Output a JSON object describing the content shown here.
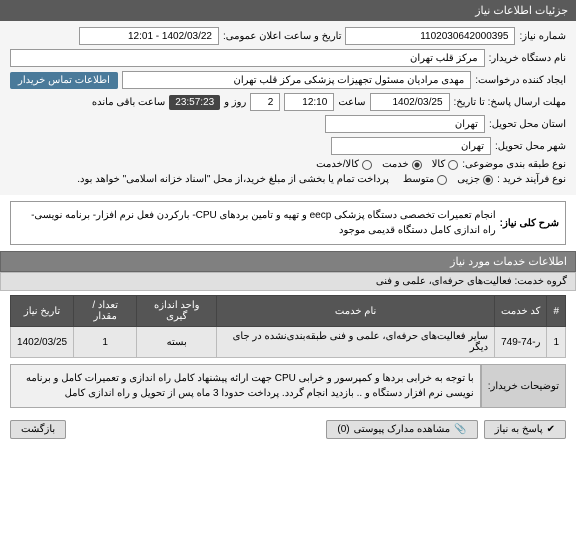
{
  "header": {
    "title": "جزئیات اطلاعات نیاز"
  },
  "fields": {
    "need_number_label": "شماره نیاز:",
    "need_number": "1102030642000395",
    "announce_label": "تاریخ و ساعت اعلان عمومی:",
    "announce_value": "1402/03/22 - 12:01",
    "buyer_org_label": "نام دستگاه خریدار:",
    "buyer_org": "مرکز قلب تهران",
    "requester_label": "ایجاد کننده درخواست:",
    "requester": "مهدی مرادیان مسئول تجهیزات پزشکی مرکز قلب تهران",
    "contact_btn": "اطلاعات تماس خریدار",
    "deadline_label": "مهلت ارسال پاسخ: تا تاریخ:",
    "deadline_date": "1402/03/25",
    "time_label": "ساعت",
    "deadline_time": "12:10",
    "days_label": "روز و",
    "days_value": "2",
    "countdown": "23:57:23",
    "remaining_label": "ساعت باقی مانده",
    "province_label": "استان محل تحویل:",
    "province": "تهران",
    "city_label": "شهر محل تحویل:",
    "city": "تهران",
    "category_label": "نوع طبقه بندی موضوعی:",
    "cat_goods": "کالا",
    "cat_service": "خدمت",
    "cat_both": "کالا/خدمت",
    "process_label": "نوع فرآیند خرید :",
    "proc_minor": "جزیی",
    "proc_medium": "متوسط",
    "proc_note": "پرداخت تمام یا بخشی از مبلغ خرید،از محل \"اسناد خزانه اسلامی\" خواهد بود."
  },
  "description": {
    "label": "شرح کلی نیاز:",
    "text": "انجام تعمیرات تخصصی دستگاه پزشکی eecp و تهیه و تامین بردهای  CPU- بارکردن فعل نرم افزار- برنامه نویسی- راه اندازی  کامل دستگاه  قدیمی موجود"
  },
  "services_section": {
    "title": "اطلاعات خدمات مورد نیاز",
    "group_label": "گروه خدمت:",
    "group_value": "فعالیت‌های حرفه‌ای، علمی و فنی"
  },
  "table": {
    "headers": [
      "#",
      "کد خدمت",
      "نام خدمت",
      "واحد اندازه گیری",
      "تعداد / مقدار",
      "تاریخ نیاز"
    ],
    "rows": [
      {
        "idx": "1",
        "code": "ر-74-749",
        "name": "سایر فعالیت‌های حرفه‌ای، علمی و فنی طبقه‌بندی‌نشده در جای دیگر",
        "unit": "بسته",
        "qty": "1",
        "date": "1402/03/25"
      }
    ]
  },
  "buyer_note": {
    "label": "توضیحات خریدار:",
    "text": "با توجه به خرابی بردها و کمپرسور و خرابی  CPU  جهت ارائه پیشنهاد کامل راه اندازی و تعمیرات کامل و برنامه نویسی نرم افزار دستگاه و .. بازدید انجام گردد. پرداخت حدودا 3 ماه پس از تحویل و راه اندازی کامل"
  },
  "footer": {
    "reply": "پاسخ به نیاز",
    "attachments": "مشاهده مدارک پیوستی",
    "attach_count": "(0)",
    "back": "بازگشت"
  }
}
